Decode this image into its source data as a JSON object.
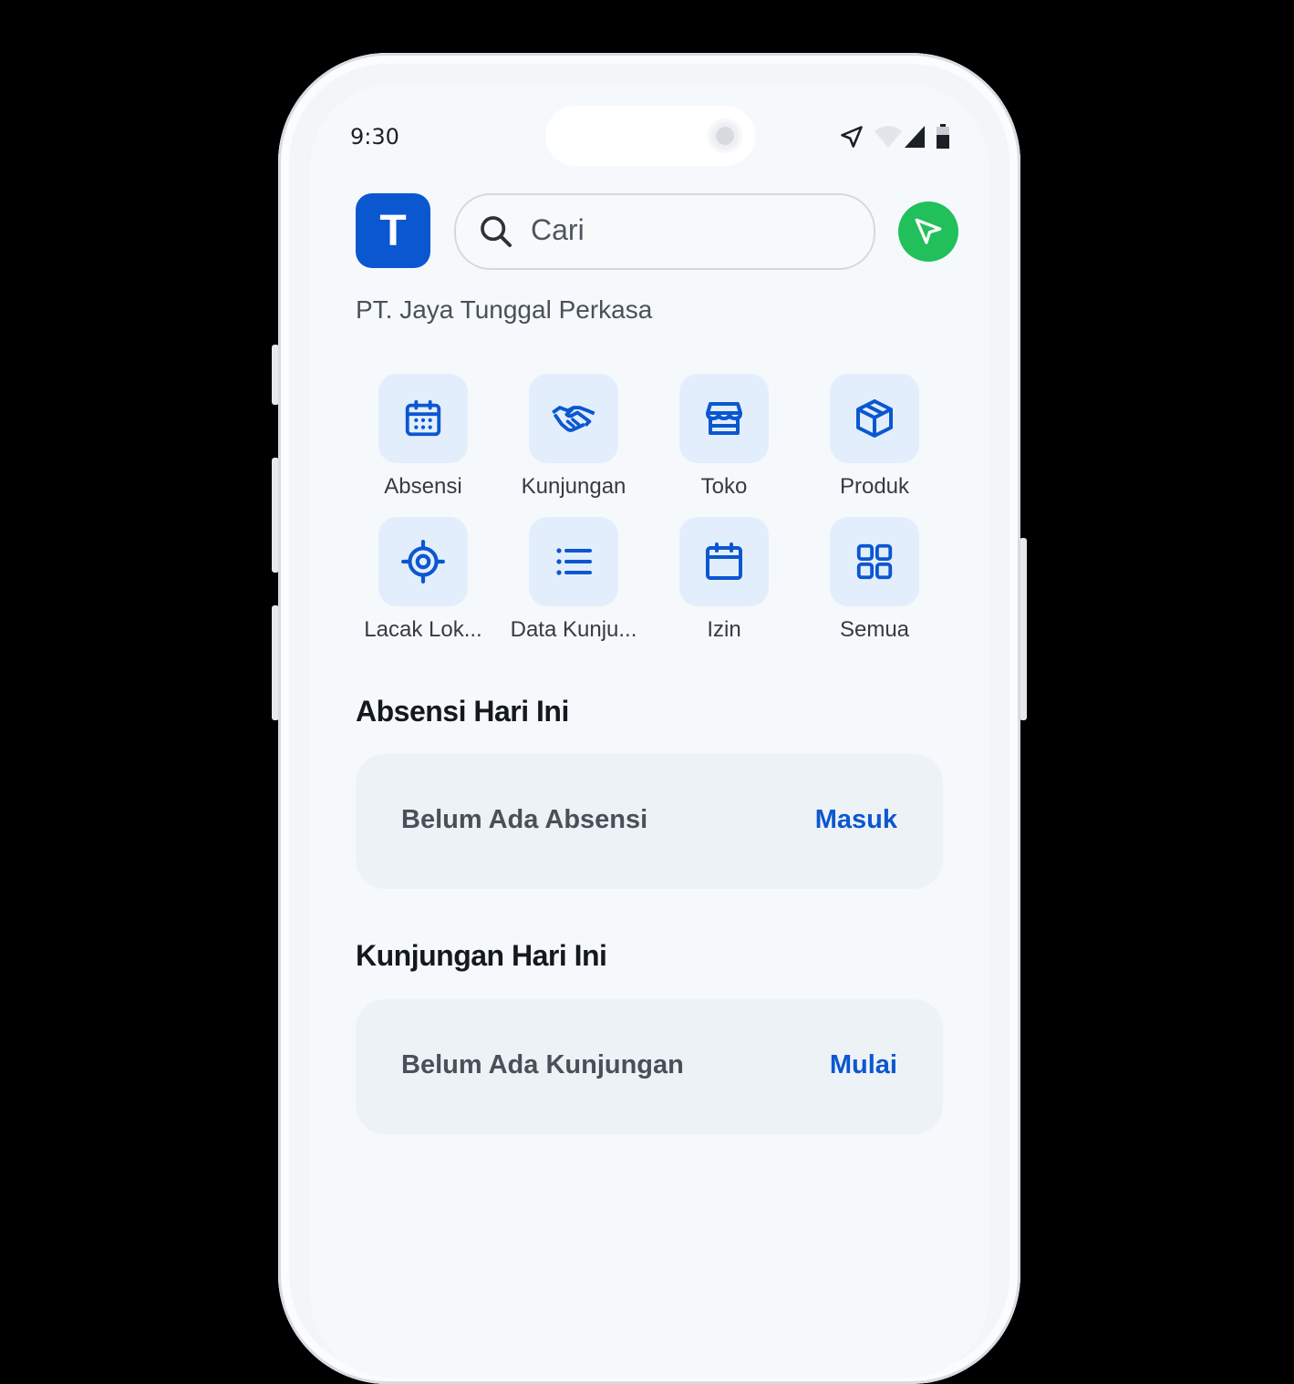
{
  "status_bar": {
    "time": "9:30",
    "icons": [
      "location-arrow-icon",
      "wifi-icon",
      "cell-signal-icon",
      "battery-icon"
    ]
  },
  "header": {
    "logo_letter": "T",
    "search_placeholder": "Cari",
    "company_name": "PT. Jaya Tunggal Perkasa"
  },
  "menu": [
    {
      "label": "Absensi",
      "icon": "calendar-grid-icon"
    },
    {
      "label": "Kunjungan",
      "icon": "handshake-icon"
    },
    {
      "label": "Toko",
      "icon": "store-icon"
    },
    {
      "label": "Produk",
      "icon": "box-icon"
    },
    {
      "label": "Lacak Lok...",
      "icon": "crosshair-icon"
    },
    {
      "label": "Data Kunju...",
      "icon": "list-icon"
    },
    {
      "label": "Izin",
      "icon": "calendar-icon"
    },
    {
      "label": "Semua",
      "icon": "grid-icon"
    }
  ],
  "attendance": {
    "title": "Absensi Hari Ini",
    "empty_text": "Belum Ada Absensi",
    "action": "Masuk"
  },
  "visits": {
    "title": "Kunjungan Hari Ini",
    "empty_text": "Belum Ada Kunjungan",
    "action": "Mulai"
  },
  "colors": {
    "primary": "#0b57d0",
    "accent_green": "#22c05a",
    "tile_bg": "#e3eefc",
    "screen_bg": "#f6f9fc"
  }
}
